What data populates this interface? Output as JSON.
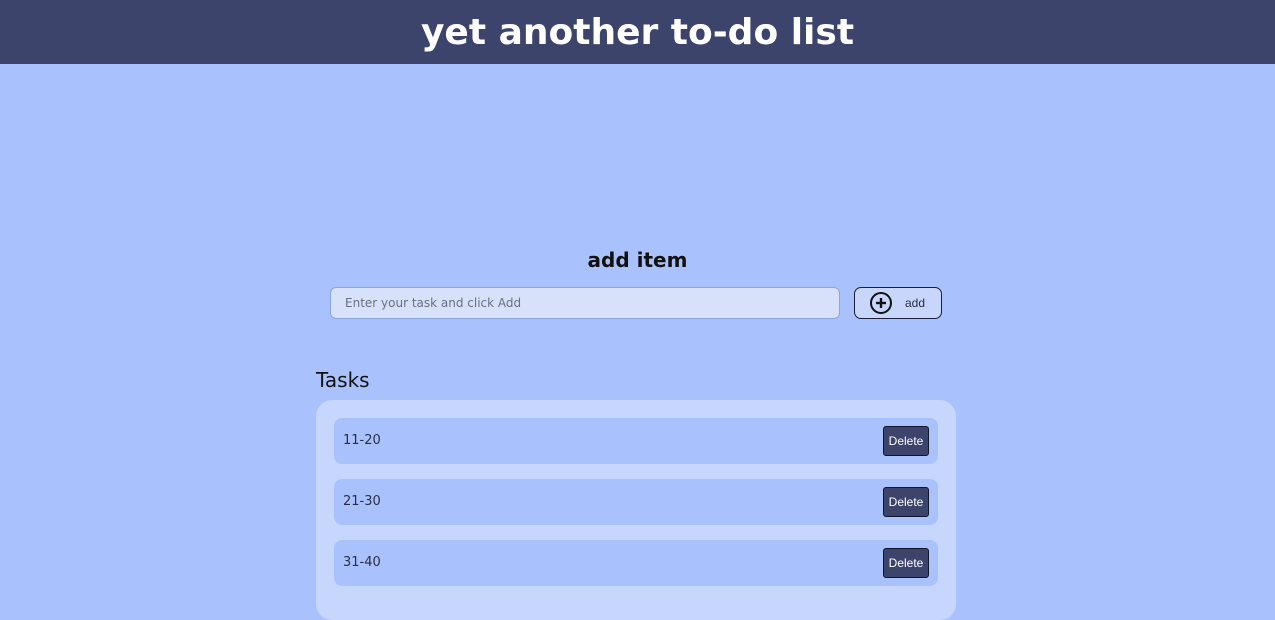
{
  "header": {
    "title": "yet another to-do list"
  },
  "add_section": {
    "heading": "add item",
    "input_placeholder": "Enter your task and click Add",
    "input_value": "",
    "add_button_label": "add",
    "add_icon": "plus-circle-icon"
  },
  "tasks_section": {
    "heading": "Tasks",
    "delete_label": "Delete",
    "items": [
      {
        "text": "11-20"
      },
      {
        "text": "21-30"
      },
      {
        "text": "31-40"
      }
    ]
  },
  "colors": {
    "header_bg": "#3d446c",
    "page_bg": "#a9c2fd",
    "panel_bg": "#c7d6fd",
    "row_bg": "#a9c2fd",
    "delete_bg": "#3d446c"
  }
}
